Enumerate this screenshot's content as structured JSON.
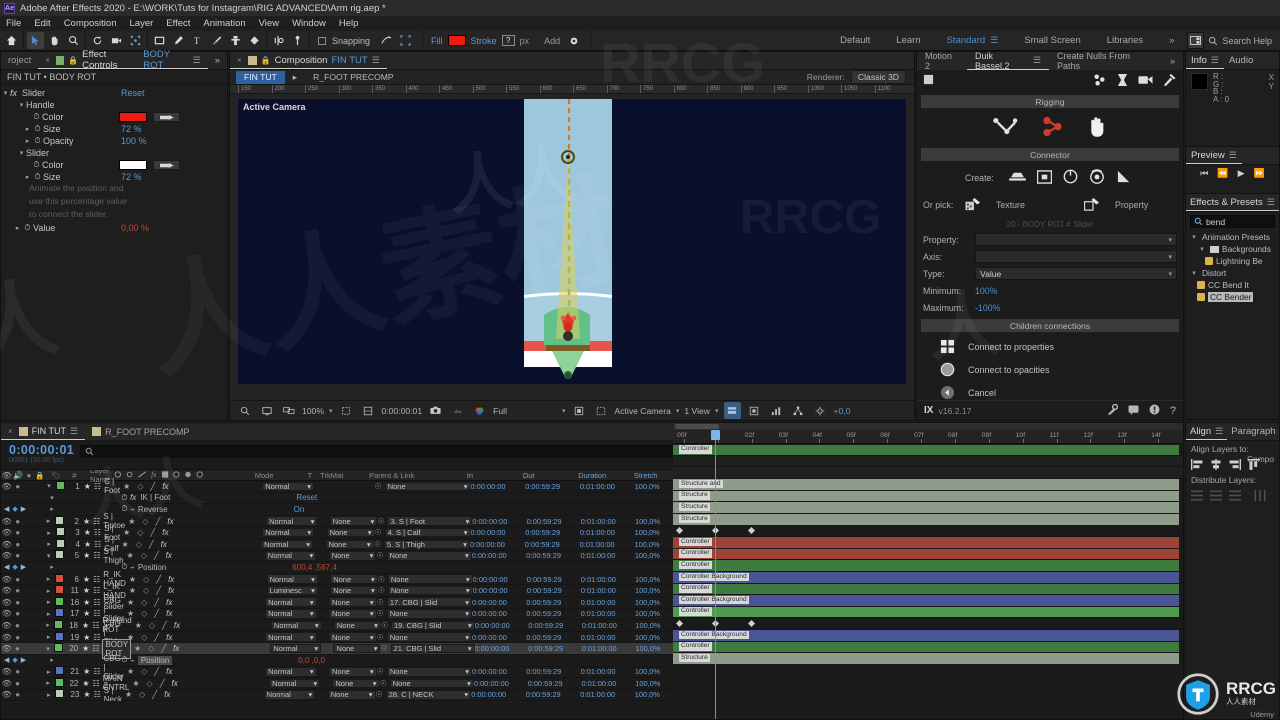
{
  "titlebar": {
    "app": "Adobe After Effects 2020",
    "doc": "E:\\WORK\\Tuts for Instagram\\RIG ADVANCED\\Arm rig.aep *",
    "logo": "Ae"
  },
  "menu": {
    "items": [
      "File",
      "Edit",
      "Composition",
      "Layer",
      "Effect",
      "Animation",
      "View",
      "Window",
      "Help"
    ]
  },
  "toolbar": {
    "snapping_label": "Snapping",
    "fill_label": "Fill",
    "fill_color": "#f11a12",
    "stroke_label": "Stroke",
    "stroke_value": "?",
    "px_label": "px",
    "add_label": "Add",
    "workspaces": [
      "Default",
      "Learn",
      "Standard",
      "Small Screen",
      "Libraries"
    ],
    "active_workspace": "Standard",
    "overflow": "»",
    "search_help": "Search Help"
  },
  "effect_controls": {
    "tab_project": "roject",
    "tab_label": "Effect Controls",
    "tab_target": "BODY ROT",
    "overflow": "»",
    "breadcrumb": "FIN TUT • BODY ROT",
    "effect_name": "Slider",
    "reset_label": "Reset",
    "groups": [
      {
        "name": "Handle",
        "props": [
          {
            "name": "Color",
            "type": "color",
            "value": "#f11a12"
          },
          {
            "name": "Size",
            "type": "num",
            "value": "72 %"
          },
          {
            "name": "Opacity",
            "type": "num",
            "value": "100 %"
          }
        ]
      },
      {
        "name": "Slider",
        "props": [
          {
            "name": "Color",
            "type": "color",
            "value": "#ffffff"
          },
          {
            "name": "Size",
            "type": "num",
            "value": "72 %"
          }
        ]
      }
    ],
    "hint_lines": [
      "Animate the position and",
      "use this percentage value",
      "to connect the slider."
    ],
    "value_prop": {
      "name": "Value",
      "value": "0,00 %"
    }
  },
  "composition": {
    "tab_label": "Composition",
    "tab_comp": "FIN TUT",
    "breadcrumbs": [
      "FIN TUT",
      "R_FOOT PRECOMP"
    ],
    "renderer_label": "Renderer:",
    "renderer_value": "Classic 3D",
    "active_camera_label": "Active Camera",
    "ruler_ticks": [
      "150",
      "200",
      "250",
      "300",
      "350",
      "400",
      "450",
      "500",
      "550",
      "600",
      "650",
      "700",
      "750",
      "800",
      "850",
      "900",
      "950",
      "1000",
      "1050",
      "1100"
    ],
    "viewer_bar": {
      "zoom": "100%",
      "timecode": "0:00:00:01",
      "resolution": "Full",
      "view_layout": "Active Camera",
      "views": "1 View",
      "exposure": "+0,0"
    }
  },
  "duik": {
    "tabs": [
      "Motion 2",
      "Duik Bassel.2",
      "Create Nulls From Paths"
    ],
    "active_tab": "Duik Bassel.2",
    "overflow": "»",
    "section_rigging": "Rigging",
    "section_connector": "Connector",
    "create_label": "Create:",
    "pick_label": "Or pick:",
    "pick_texture": "Texture",
    "pick_property": "Property",
    "ghost_label": "20 - BODY ROT # Slider",
    "fields": [
      {
        "label": "Property:",
        "value": ""
      },
      {
        "label": "Axis:",
        "value": ""
      },
      {
        "label": "Type:",
        "value": "Value"
      }
    ],
    "minimum_label": "Minimum:",
    "minimum_value": "100%",
    "maximum_label": "Maximum:",
    "maximum_value": "-100%",
    "section_children": "Children connections",
    "actions": [
      "Connect to properties",
      "Connect to opacities",
      "Cancel"
    ],
    "version": "v16.2.17",
    "brand": "IX"
  },
  "info_panel": {
    "tabs": [
      "Info",
      "Audio"
    ],
    "channels": [
      "R :",
      "G :",
      "B :",
      "A :"
    ],
    "alpha_value": "0",
    "xy": [
      "X",
      "Y"
    ]
  },
  "preview_panel": {
    "title": "Preview"
  },
  "effects_presets": {
    "title": "Effects & Presets",
    "search_value": "bend",
    "tree": [
      {
        "label": "Animation Presets",
        "level": 0,
        "type": "root"
      },
      {
        "label": "Backgrounds",
        "level": 1,
        "type": "folder"
      },
      {
        "label": "Lightning Be",
        "level": 2,
        "type": "preset"
      },
      {
        "label": "Distort",
        "level": 0,
        "type": "root"
      },
      {
        "label": "CC Bend It",
        "level": 1,
        "type": "preset"
      },
      {
        "label": "CC Bender",
        "level": 1,
        "type": "preset",
        "selected": true
      }
    ]
  },
  "align_panel": {
    "tabs": [
      "Align",
      "Paragraph"
    ],
    "align_layers_to_label": "Align Layers to:",
    "align_target": "Compo",
    "distribute_label": "Distribute Layers:"
  },
  "timeline": {
    "tabs": [
      {
        "label": "FIN TUT",
        "active": true,
        "color": "#c9bb8f"
      },
      {
        "label": "R_FOOT PRECOMP",
        "active": false,
        "color": "#c9bb8f"
      }
    ],
    "timecode": "0:00:00:01",
    "timecode_sub": "00001 (30.00 fps)",
    "columns": [
      "Layer Name",
      "Mode",
      "T",
      "TrkMat",
      "Parent & Link",
      "In",
      "Out",
      "Duration",
      "Stretch"
    ],
    "ruler_ticks": [
      "00f",
      "01f",
      "02f",
      "03f",
      "04f",
      "05f",
      "06f",
      "07f",
      "08f",
      "09f",
      "10f",
      "11f",
      "12f",
      "13f",
      "14f"
    ],
    "rows": [
      {
        "kind": "layer",
        "num": "1",
        "name": "C | Foot",
        "color": "#5bbd5b",
        "mode": "Normal",
        "trkmat": "",
        "parent": "None",
        "in": "0:00:00:00",
        "out": "0:00:59:29",
        "duration": "0:01:00:00",
        "stretch": "100,0%",
        "bar": "Controller",
        "barcolor": "#3f7a3f",
        "expanded": true
      },
      {
        "kind": "prop",
        "name": "IK | Foot",
        "value": "Reset",
        "fx": "fx"
      },
      {
        "kind": "prop",
        "name": "Reverse",
        "value": "On",
        "keys": true
      },
      {
        "kind": "layer",
        "num": "2",
        "name": "S | Tiptoe",
        "color": "#b9ceb4",
        "mode": "Normal",
        "trkmat": "None",
        "parent": "3. S | Foot",
        "in": "0:00:00:00",
        "out": "0:00:59:29",
        "duration": "0:01:00:00",
        "stretch": "100,0%",
        "bar": "Structure and",
        "barcolor": "#8f9b8b"
      },
      {
        "kind": "layer",
        "num": "3",
        "name": "S | Foot",
        "color": "#b9ceb4",
        "mode": "Normal",
        "trkmat": "None",
        "parent": "4. S | Calf",
        "in": "0:00:00:00",
        "out": "0:00:59:29",
        "duration": "0:01:00:00",
        "stretch": "100,0%",
        "bar": "Structure",
        "barcolor": "#8f9b8b"
      },
      {
        "kind": "layer",
        "num": "4",
        "name": "S | Calf",
        "color": "#b9ceb4",
        "mode": "Normal",
        "trkmat": "None",
        "parent": "5. S | Thigh",
        "in": "0:00:00:00",
        "out": "0:00:59:29",
        "duration": "0:01:00:00",
        "stretch": "100,0%",
        "bar": "Structure",
        "barcolor": "#8f9b8b"
      },
      {
        "kind": "layer",
        "num": "5",
        "name": "S | Thigh",
        "color": "#b9ceb4",
        "mode": "Normal",
        "trkmat": "None",
        "parent": "None",
        "in": "0:00:00:00",
        "out": "0:00:59:29",
        "duration": "0:01:00:00",
        "stretch": "100,0%",
        "bar": "Structure",
        "barcolor": "#8f9b8b",
        "expanded": true
      },
      {
        "kind": "prop",
        "name": "Position",
        "value": "600,4 ,567,4",
        "keys": true,
        "kfrow": true
      },
      {
        "kind": "layer",
        "num": "6",
        "name": "R_IK HAND",
        "color": "#d4503f",
        "mode": "Normal",
        "trkmat": "None",
        "parent": "None",
        "in": "0:00:00:00",
        "out": "0:00:59:29",
        "duration": "0:01:00:00",
        "stretch": "100,0%",
        "bar": "Controller",
        "barcolor": "#9c4437"
      },
      {
        "kind": "layer",
        "num": "11",
        "name": "L_IK HAND",
        "color": "#d4503f",
        "mode": "Luminesc",
        "trkmat": "None",
        "parent": "None",
        "in": "0:00:00:00",
        "out": "0:00:59:29",
        "duration": "0:01:00:00",
        "stretch": "100,0%",
        "bar": "Controller",
        "barcolor": "#9c4437"
      },
      {
        "kind": "layer",
        "num": "16",
        "name": "C | Slider",
        "color": "#5bbd5b",
        "mode": "Normal",
        "trkmat": "None",
        "parent": "17. CBG | Slid",
        "in": "0:00:00:00",
        "out": "0:00:59:29",
        "duration": "0:01:00:00",
        "stretch": "100,0%",
        "bar": "Controller",
        "barcolor": "#3f7a3f"
      },
      {
        "kind": "layer",
        "num": "17",
        "name": "CBG | Slider 4",
        "color": "#5b73c4",
        "mode": "Normal",
        "trkmat": "None",
        "parent": "None",
        "in": "0:00:00:00",
        "out": "0:00:59:29",
        "duration": "0:01:00:00",
        "stretch": "100,0%",
        "bar": "Controller Background",
        "barcolor": "#4a5596"
      },
      {
        "kind": "layer",
        "num": "18",
        "name": "R_Hand ROT",
        "color": "#5bbd5b",
        "mode": "Normal",
        "trkmat": "None",
        "parent": "19. CBG | Slid",
        "in": "0:00:00:00",
        "out": "0:00:59:29",
        "duration": "0:01:00:00",
        "stretch": "100,0%",
        "bar": "Controller",
        "barcolor": "#3f7a3f"
      },
      {
        "kind": "layer",
        "num": "19",
        "name": "CBG | Slider 3",
        "color": "#5b73c4",
        "mode": "Normal",
        "trkmat": "None",
        "parent": "None",
        "in": "0:00:00:00",
        "out": "0:00:59:29",
        "duration": "0:01:00:00",
        "stretch": "100,0%",
        "bar": "Controller Background",
        "barcolor": "#4a5596"
      },
      {
        "kind": "layer",
        "num": "20",
        "name": "BODY ROT",
        "color": "#5bbd5b",
        "mode": "Normal",
        "trkmat": "None",
        "parent": "21. CBG | Slid",
        "in": "0:00:00:00",
        "out": "0:00:59:29",
        "duration": "0:01:00:00",
        "stretch": "100,0%",
        "bar": "Controller",
        "barcolor": "#4f9b4f",
        "selected": true,
        "renaming": true,
        "expanded": true
      },
      {
        "kind": "prop",
        "name": "Position",
        "value": "0,0 ,0,0",
        "keys": true,
        "kfrow": true,
        "highlight": true
      },
      {
        "kind": "layer",
        "num": "21",
        "name": "CBG | Slider 2",
        "color": "#5b73c4",
        "mode": "Normal",
        "trkmat": "None",
        "parent": "None",
        "in": "0:00:00:00",
        "out": "0:00:59:29",
        "duration": "0:01:00:00",
        "stretch": "100,0%",
        "bar": "Controller Background",
        "barcolor": "#4a5596"
      },
      {
        "kind": "layer",
        "num": "22",
        "name": "MAIN CNTRL",
        "color": "#5bbd5b",
        "mode": "Normal",
        "trkmat": "None",
        "parent": "None",
        "in": "0:00:00:00",
        "out": "0:00:59:29",
        "duration": "0:01:00:00",
        "stretch": "100,0%",
        "bar": "Controller",
        "barcolor": "#3f7a3f"
      },
      {
        "kind": "layer",
        "num": "23",
        "name": "S | Neck",
        "color": "#b9ceb4",
        "mode": "Normal",
        "trkmat": "None",
        "parent": "28. C | NECK",
        "in": "0:00:00:00",
        "out": "0:00:59:29",
        "duration": "0:01:00:00",
        "stretch": "100,0%",
        "bar": "Structure",
        "barcolor": "#8f9b8b"
      }
    ]
  },
  "branding": {
    "rrcg": "RRCG",
    "rrcg_sub": "人人素材",
    "udemy": "Udemy"
  },
  "watermarks": [
    "RRCG",
    "人人素材"
  ]
}
